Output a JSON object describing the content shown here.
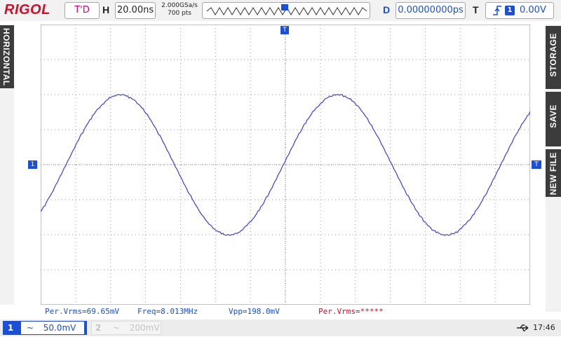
{
  "brand": "RIGOL",
  "mode": "T'D",
  "horizontal": {
    "label": "H",
    "timebase": "20.00ns",
    "sample_rate": "2.000GSa/s",
    "memory": "700 pts"
  },
  "delay": {
    "label": "D",
    "value": "0.00000000ps"
  },
  "trigger": {
    "label": "T",
    "channel": "1",
    "level": "0.00V"
  },
  "side": {
    "left_tab": "HORIZONTAL",
    "right_save": "SAVE",
    "right_storage": "STORAGE",
    "right_new": "NEW FILE"
  },
  "markers": {
    "ch1": "1",
    "trig": "T"
  },
  "measurements": [
    {
      "text": "Per.Vrms=69.65mV",
      "color": "#1a4fd6"
    },
    {
      "text": "Freq=8.013MHz",
      "color": "#1a4fd6"
    },
    {
      "text": "Vpp=198.0mV",
      "color": "#1a4fd6"
    },
    {
      "text": "Per.Vrms=*****",
      "color": "#d0102a"
    }
  ],
  "channels": [
    {
      "num": "1",
      "coupling": "~",
      "scale": "50.0mV",
      "active": true
    },
    {
      "num": "2",
      "coupling": "~",
      "scale": "200mV",
      "active": false
    }
  ],
  "status": {
    "usb_icon": "usb-icon",
    "time": "17:46"
  },
  "colors": {
    "ch1": "#1a4fd6",
    "trace": "#3a3fd8",
    "grid": "#888888",
    "brand": "#d0102a"
  },
  "chart_data": {
    "type": "line",
    "series": [
      {
        "values": [
          -0.65,
          0,
          0.99,
          0,
          -0.99,
          0,
          0.99,
          0,
          -0.99,
          0,
          0.6
        ]
      }
    ],
    "frequency": "8.013MHz",
    "vpp": "198.0mV"
  }
}
